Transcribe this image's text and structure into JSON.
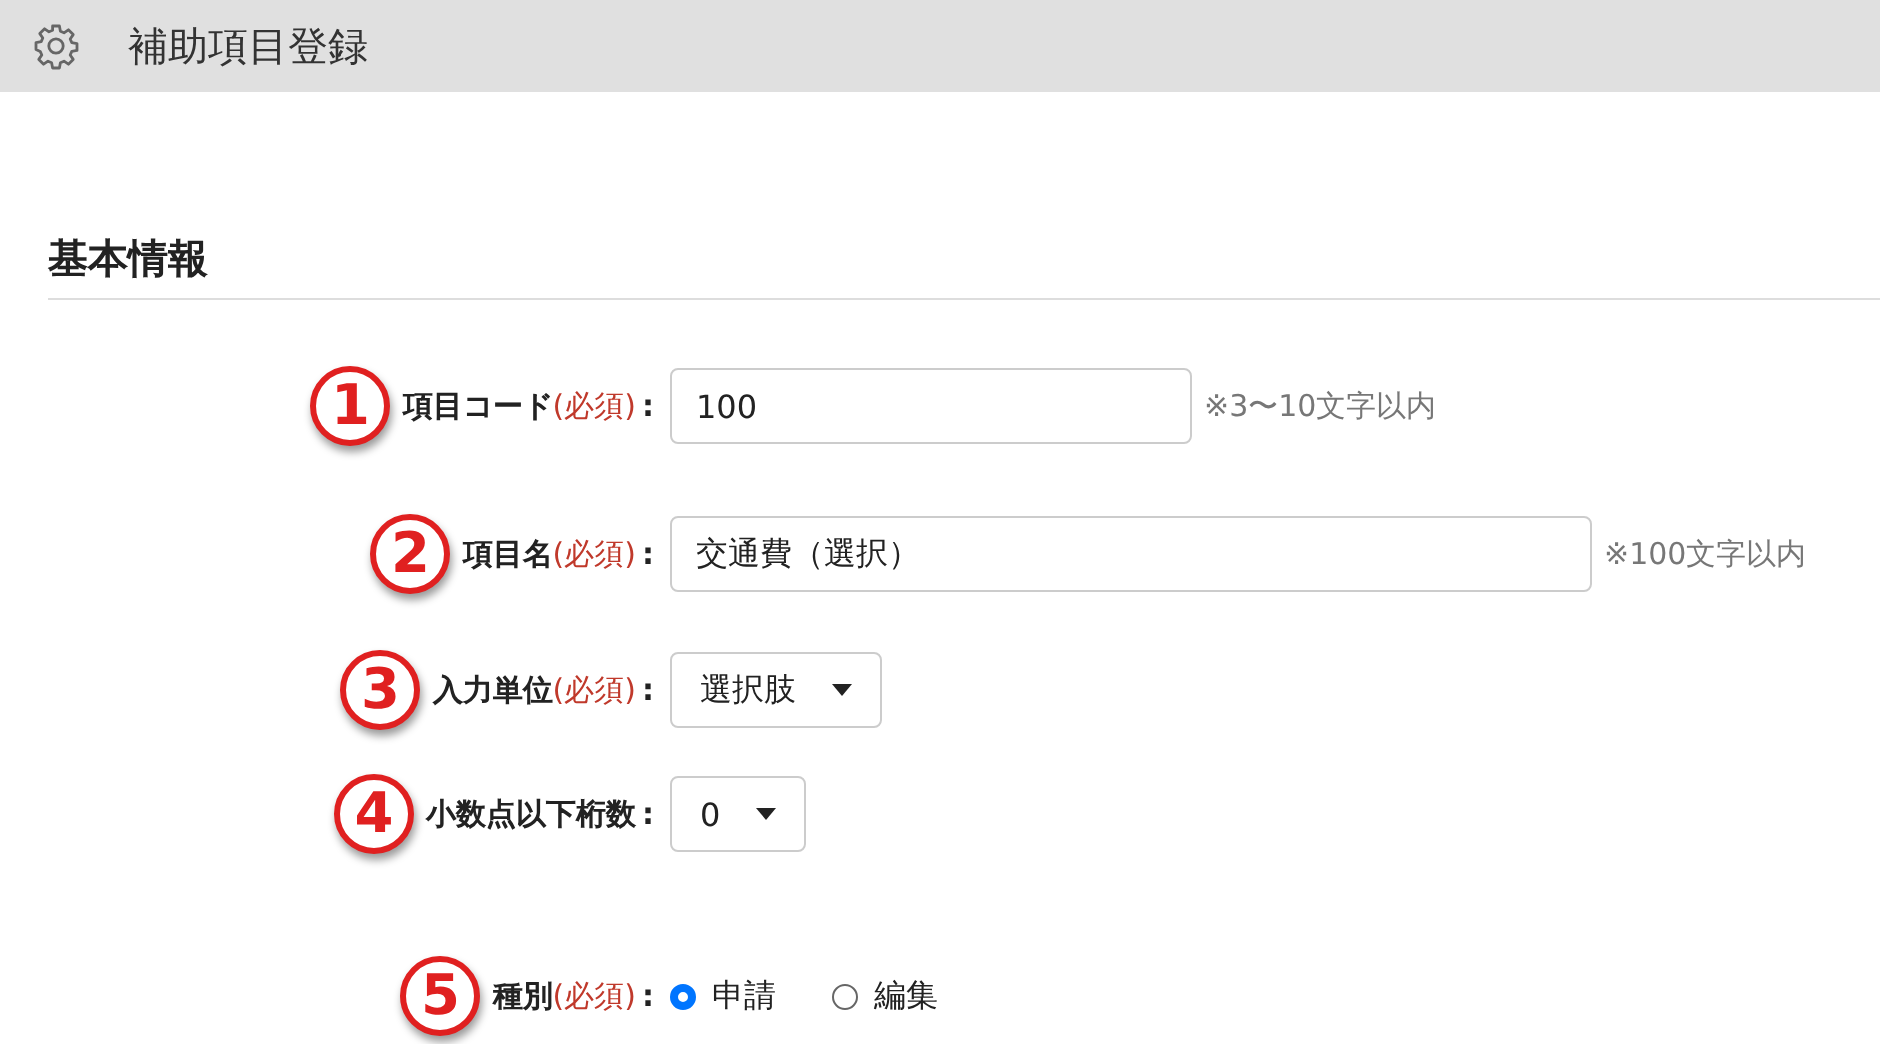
{
  "header": {
    "title": "補助項目登録"
  },
  "section": {
    "title": "基本情報"
  },
  "rows": [
    {
      "marker": "1",
      "label": "項目コード",
      "required": "(必須)",
      "colon": ":",
      "kind": "text",
      "value": "100",
      "hint": "※3〜10文字以内"
    },
    {
      "marker": "2",
      "label": "項目名",
      "required": "(必須)",
      "colon": ":",
      "kind": "text",
      "value": "交通費（選択）",
      "hint": "※100文字以内"
    },
    {
      "marker": "3",
      "label": "入力単位",
      "required": "(必須)",
      "colon": ":",
      "kind": "select",
      "value": "選択肢"
    },
    {
      "marker": "4",
      "label": "小数点以下桁数",
      "colon": ":",
      "kind": "select",
      "value": "0"
    },
    {
      "marker": "5",
      "label": "種別",
      "required": "(必須)",
      "colon": ":",
      "kind": "radio",
      "options": [
        {
          "label": "申請",
          "selected": true
        },
        {
          "label": "編集",
          "selected": false
        }
      ]
    }
  ]
}
